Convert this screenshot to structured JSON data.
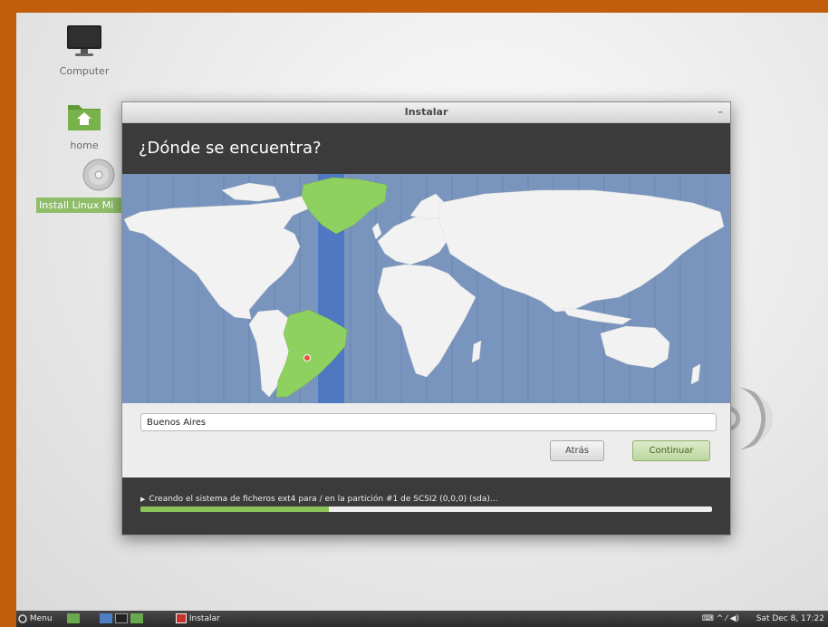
{
  "desktop": {
    "icons": [
      {
        "label": "Computer"
      },
      {
        "label": "home"
      },
      {
        "label": "Install Linux Mi"
      }
    ]
  },
  "window": {
    "title": "Instalar",
    "minimize": "–",
    "heading": "¿Dónde se encuentra?",
    "city_value": "Buenos Aires",
    "back_label": "Atrás",
    "continue_label": "Continuar",
    "progress_text": "Creando el sistema de ficheros ext4 para / en la partición #1 de SCSI2 (0,0,0) (sda)...",
    "progress_fraction": 0.33
  },
  "taskbar": {
    "menu_label": "Menu",
    "task_label": "Instalar",
    "clock": "Sat Dec  8, 17:22"
  },
  "colors": {
    "highlight_green": "#8fd160",
    "map_ocean": "#7a95bd",
    "selected_timezone_band": "#4f78c2"
  }
}
